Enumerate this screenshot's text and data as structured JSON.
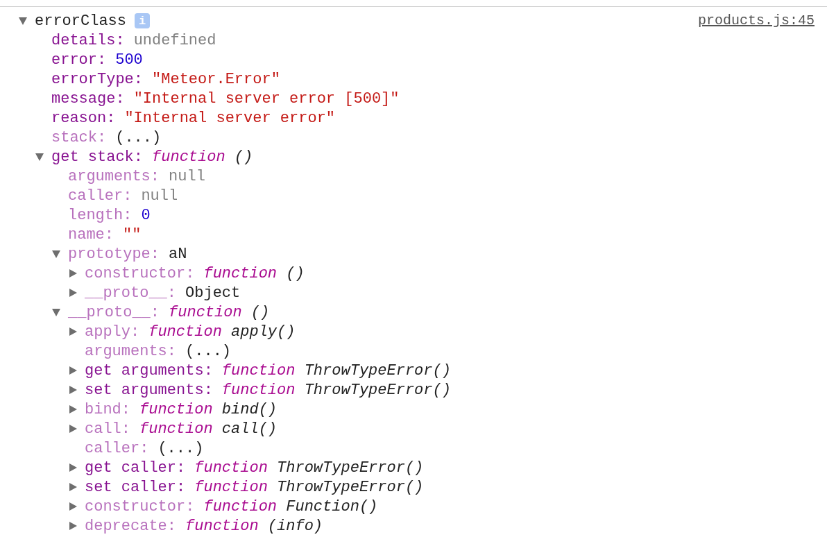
{
  "root": {
    "name": "errorClass",
    "expanded": true,
    "badge": "i",
    "source_link": "products.js:45",
    "children": [
      {
        "name": "details:",
        "dim": false,
        "value": [
          {
            "text": "undefined",
            "kind": "gray"
          }
        ]
      },
      {
        "name": "error:",
        "dim": false,
        "value": [
          {
            "text": "500",
            "kind": "number"
          }
        ]
      },
      {
        "name": "errorType:",
        "dim": false,
        "value": [
          {
            "text": "\"Meteor.Error\"",
            "kind": "string"
          }
        ]
      },
      {
        "name": "message:",
        "dim": false,
        "value": [
          {
            "text": "\"Internal server error [500]\"",
            "kind": "string"
          }
        ]
      },
      {
        "name": "reason:",
        "dim": false,
        "value": [
          {
            "text": "\"Internal server error\"",
            "kind": "string"
          }
        ]
      },
      {
        "name": "stack:",
        "dim": true,
        "value": [
          {
            "text": "(...)",
            "kind": "plain"
          }
        ]
      },
      {
        "name": "get stack:",
        "dim": false,
        "expanded": true,
        "value": [
          {
            "text": "function",
            "kind": "keyword"
          },
          {
            "text": "()",
            "kind": "signature"
          }
        ],
        "children": [
          {
            "name": "arguments:",
            "dim": true,
            "value": [
              {
                "text": "null",
                "kind": "gray"
              }
            ]
          },
          {
            "name": "caller:",
            "dim": true,
            "value": [
              {
                "text": "null",
                "kind": "gray"
              }
            ]
          },
          {
            "name": "length:",
            "dim": true,
            "value": [
              {
                "text": "0",
                "kind": "number"
              }
            ]
          },
          {
            "name": "name:",
            "dim": true,
            "value": [
              {
                "text": "\"\"",
                "kind": "string"
              }
            ]
          },
          {
            "name": "prototype:",
            "dim": true,
            "expanded": true,
            "value": [
              {
                "text": "aN",
                "kind": "plain"
              }
            ],
            "children": [
              {
                "name": "constructor:",
                "dim": true,
                "expanded": false,
                "value": [
                  {
                    "text": "function",
                    "kind": "keyword"
                  },
                  {
                    "text": "()",
                    "kind": "signature"
                  }
                ]
              },
              {
                "name": "__proto__:",
                "dim": true,
                "expanded": false,
                "value": [
                  {
                    "text": "Object",
                    "kind": "plain"
                  }
                ]
              }
            ]
          },
          {
            "name": "__proto__:",
            "dim": true,
            "expanded": true,
            "value": [
              {
                "text": "function",
                "kind": "keyword"
              },
              {
                "text": "()",
                "kind": "signature"
              }
            ],
            "children": [
              {
                "name": "apply:",
                "dim": true,
                "expanded": false,
                "value": [
                  {
                    "text": "function",
                    "kind": "keyword"
                  },
                  {
                    "text": "apply()",
                    "kind": "signature"
                  }
                ]
              },
              {
                "name": "arguments:",
                "dim": true,
                "value": [
                  {
                    "text": "(...)",
                    "kind": "plain"
                  }
                ]
              },
              {
                "name": "get arguments:",
                "dim": false,
                "expanded": false,
                "value": [
                  {
                    "text": "function",
                    "kind": "keyword"
                  },
                  {
                    "text": "ThrowTypeError()",
                    "kind": "signature"
                  }
                ]
              },
              {
                "name": "set arguments:",
                "dim": false,
                "expanded": false,
                "value": [
                  {
                    "text": "function",
                    "kind": "keyword"
                  },
                  {
                    "text": "ThrowTypeError()",
                    "kind": "signature"
                  }
                ]
              },
              {
                "name": "bind:",
                "dim": true,
                "expanded": false,
                "value": [
                  {
                    "text": "function",
                    "kind": "keyword"
                  },
                  {
                    "text": "bind()",
                    "kind": "signature"
                  }
                ]
              },
              {
                "name": "call:",
                "dim": true,
                "expanded": false,
                "value": [
                  {
                    "text": "function",
                    "kind": "keyword"
                  },
                  {
                    "text": "call()",
                    "kind": "signature"
                  }
                ]
              },
              {
                "name": "caller:",
                "dim": true,
                "value": [
                  {
                    "text": "(...)",
                    "kind": "plain"
                  }
                ]
              },
              {
                "name": "get caller:",
                "dim": false,
                "expanded": false,
                "value": [
                  {
                    "text": "function",
                    "kind": "keyword"
                  },
                  {
                    "text": "ThrowTypeError()",
                    "kind": "signature"
                  }
                ]
              },
              {
                "name": "set caller:",
                "dim": false,
                "expanded": false,
                "value": [
                  {
                    "text": "function",
                    "kind": "keyword"
                  },
                  {
                    "text": "ThrowTypeError()",
                    "kind": "signature"
                  }
                ]
              },
              {
                "name": "constructor:",
                "dim": true,
                "expanded": false,
                "value": [
                  {
                    "text": "function",
                    "kind": "keyword"
                  },
                  {
                    "text": "Function()",
                    "kind": "signature"
                  }
                ]
              },
              {
                "name": "deprecate:",
                "dim": true,
                "expanded": false,
                "value": [
                  {
                    "text": "function",
                    "kind": "keyword"
                  },
                  {
                    "text": "(info)",
                    "kind": "signature"
                  }
                ]
              }
            ]
          }
        ]
      }
    ]
  }
}
